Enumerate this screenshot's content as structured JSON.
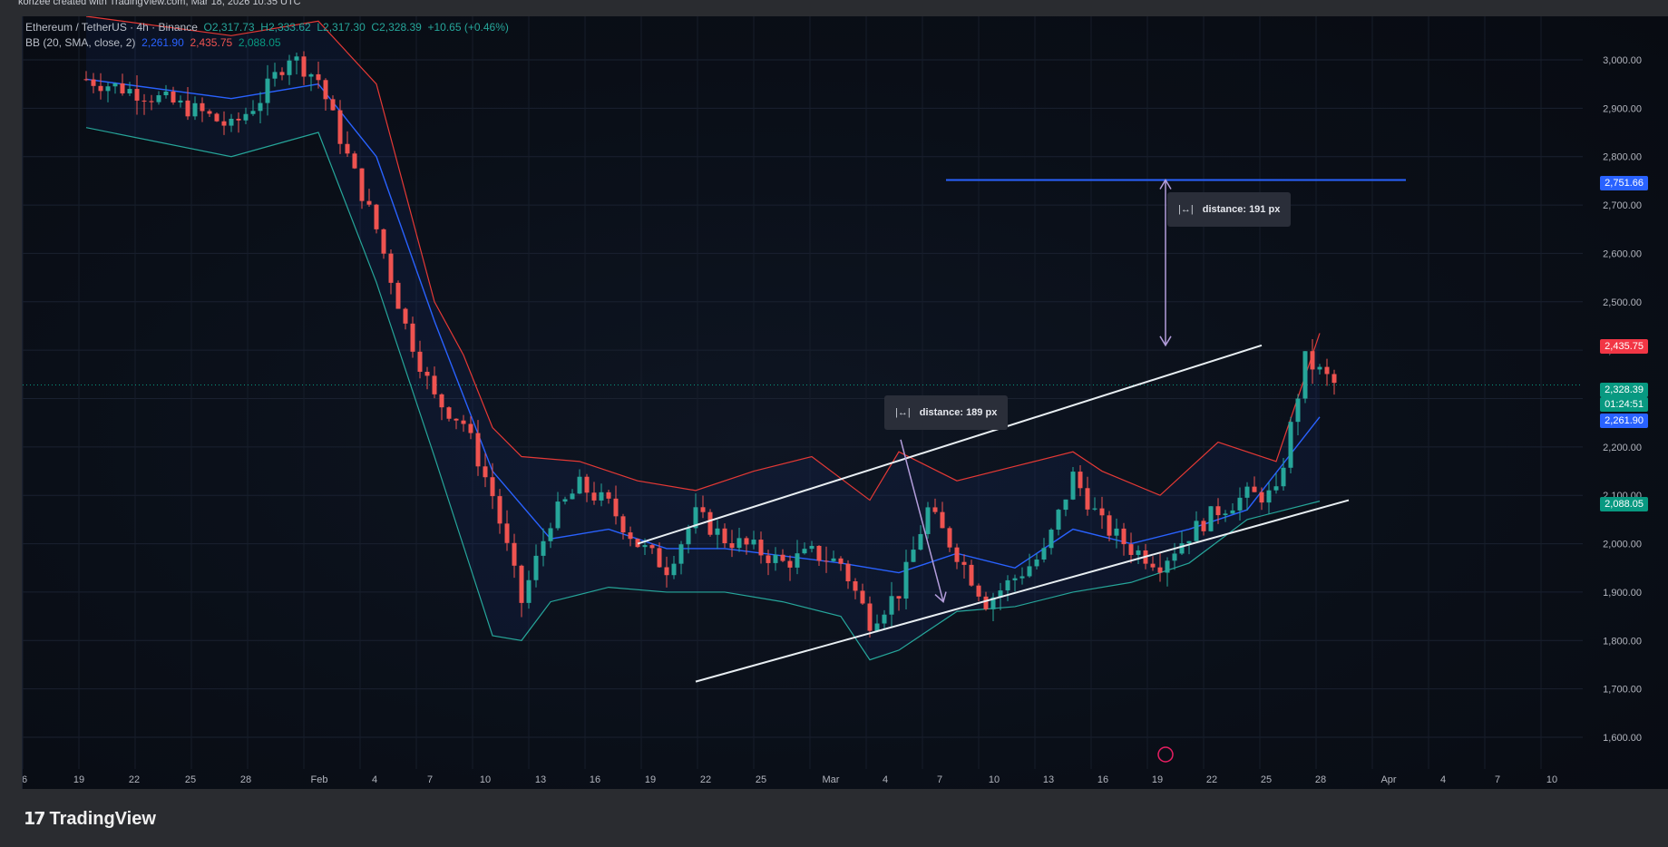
{
  "caption": "kohzee created with TradingView.com, Mar 18, 2026 10:35 UTC",
  "legend": {
    "symbol": "Ethereum / TetherUS · 4h · Binance",
    "open_label": "O",
    "open": "2,317.73",
    "high_label": "H",
    "high": "2,333.62",
    "low_label": "L",
    "low": "2,317.30",
    "close_label": "C",
    "close": "2,328.39",
    "change": "+10.65 (+0.46%)",
    "indicator": "BB (20, SMA, close, 2)",
    "bb_basis": "2,261.90",
    "bb_upper": "2,435.75",
    "bb_lower": "2,088.05"
  },
  "price_tags": {
    "target": "2,751.66",
    "upper": "2,435.75",
    "last": "2,328.39",
    "countdown": "01:24:51",
    "basis": "2,261.90",
    "lower": "2,088.05"
  },
  "tooltips": {
    "upper": "distance: 191 px",
    "lower": "distance: 189 px"
  },
  "brand": "TradingView",
  "colors": {
    "up": "#26a69a",
    "down": "#ef5350",
    "basis": "#2962ff",
    "upper_band": "#e53935",
    "lower_band": "#26a69a",
    "channel": "#e8eef2",
    "target_line": "#2962ff",
    "measure": "#b39ddb"
  },
  "chart_data": {
    "type": "candlestick",
    "symbol": "ETH/USDT",
    "timeframe": "4h",
    "ylim": [
      1550,
      3080
    ],
    "y_ticks": [
      "3,000.00",
      "2,900.00",
      "2,800.00",
      "2,700.00",
      "2,600.00",
      "2,500.00",
      "2,400.00",
      "2,300.00",
      "2,200.00",
      "2,100.00",
      "2,000.00",
      "1,900.00",
      "1,800.00",
      "1,700.00",
      "1,600.00"
    ],
    "x_ticks": [
      "6",
      "19",
      "22",
      "25",
      "28",
      "Feb",
      "4",
      "7",
      "10",
      "13",
      "16",
      "19",
      "22",
      "25",
      "Mar",
      "4",
      "7",
      "10",
      "13",
      "16",
      "19",
      "22",
      "25",
      "28",
      "Apr",
      "4",
      "7",
      "10"
    ],
    "price_path": [
      [
        0,
        2960
      ],
      [
        4,
        2930
      ],
      [
        8,
        2890
      ],
      [
        10,
        2860
      ],
      [
        12,
        2920
      ],
      [
        14,
        3010
      ],
      [
        16,
        2960
      ],
      [
        18,
        2800
      ],
      [
        20,
        2650
      ],
      [
        22,
        2450
      ],
      [
        24,
        2300
      ],
      [
        26,
        2250
      ],
      [
        28,
        2100
      ],
      [
        30,
        1880
      ],
      [
        32,
        2050
      ],
      [
        34,
        2120
      ],
      [
        36,
        2080
      ],
      [
        38,
        2000
      ],
      [
        40,
        1950
      ],
      [
        42,
        2060
      ],
      [
        44,
        2010
      ],
      [
        46,
        1990
      ],
      [
        48,
        1960
      ],
      [
        50,
        1980
      ],
      [
        52,
        1960
      ],
      [
        54,
        1840
      ],
      [
        56,
        1900
      ],
      [
        58,
        2070
      ],
      [
        60,
        1980
      ],
      [
        62,
        1880
      ],
      [
        64,
        1930
      ],
      [
        66,
        1980
      ],
      [
        68,
        2140
      ],
      [
        70,
        2040
      ],
      [
        72,
        1990
      ],
      [
        74,
        1960
      ],
      [
        76,
        2020
      ],
      [
        78,
        2070
      ],
      [
        80,
        2100
      ],
      [
        82,
        2100
      ],
      [
        84,
        2380
      ],
      [
        86,
        2330
      ]
    ],
    "bb_upper": [
      [
        0,
        3090
      ],
      [
        10,
        3050
      ],
      [
        16,
        3080
      ],
      [
        20,
        2950
      ],
      [
        24,
        2500
      ],
      [
        26,
        2390
      ],
      [
        28,
        2240
      ],
      [
        30,
        2180
      ],
      [
        34,
        2170
      ],
      [
        38,
        2130
      ],
      [
        42,
        2110
      ],
      [
        46,
        2150
      ],
      [
        50,
        2180
      ],
      [
        54,
        2090
      ],
      [
        56,
        2190
      ],
      [
        60,
        2130
      ],
      [
        64,
        2160
      ],
      [
        68,
        2190
      ],
      [
        70,
        2150
      ],
      [
        74,
        2100
      ],
      [
        78,
        2210
      ],
      [
        82,
        2170
      ],
      [
        85,
        2435
      ]
    ],
    "bb_basis": [
      [
        0,
        2960
      ],
      [
        10,
        2920
      ],
      [
        16,
        2950
      ],
      [
        20,
        2800
      ],
      [
        24,
        2460
      ],
      [
        28,
        2150
      ],
      [
        32,
        2010
      ],
      [
        36,
        2030
      ],
      [
        40,
        1990
      ],
      [
        44,
        1990
      ],
      [
        48,
        1975
      ],
      [
        52,
        1960
      ],
      [
        56,
        1940
      ],
      [
        60,
        1980
      ],
      [
        64,
        1950
      ],
      [
        68,
        2030
      ],
      [
        72,
        2000
      ],
      [
        76,
        2030
      ],
      [
        80,
        2070
      ],
      [
        85,
        2262
      ]
    ],
    "bb_lower": [
      [
        0,
        2860
      ],
      [
        10,
        2800
      ],
      [
        16,
        2850
      ],
      [
        20,
        2540
      ],
      [
        24,
        2180
      ],
      [
        28,
        1810
      ],
      [
        30,
        1800
      ],
      [
        32,
        1880
      ],
      [
        36,
        1910
      ],
      [
        40,
        1900
      ],
      [
        44,
        1900
      ],
      [
        48,
        1880
      ],
      [
        52,
        1850
      ],
      [
        54,
        1760
      ],
      [
        56,
        1780
      ],
      [
        60,
        1860
      ],
      [
        64,
        1870
      ],
      [
        68,
        1900
      ],
      [
        72,
        1920
      ],
      [
        76,
        1960
      ],
      [
        80,
        2050
      ],
      [
        85,
        2088
      ]
    ],
    "channel_upper": [
      [
        38,
        2000
      ],
      [
        81,
        2410
      ]
    ],
    "channel_lower": [
      [
        42,
        1715
      ],
      [
        87,
        2090
      ]
    ],
    "target_level": 2751.66,
    "measure_upper": {
      "from": 2410,
      "to": 2751.66
    },
    "measure_lower": {
      "from": 2215,
      "to": 1880
    }
  }
}
